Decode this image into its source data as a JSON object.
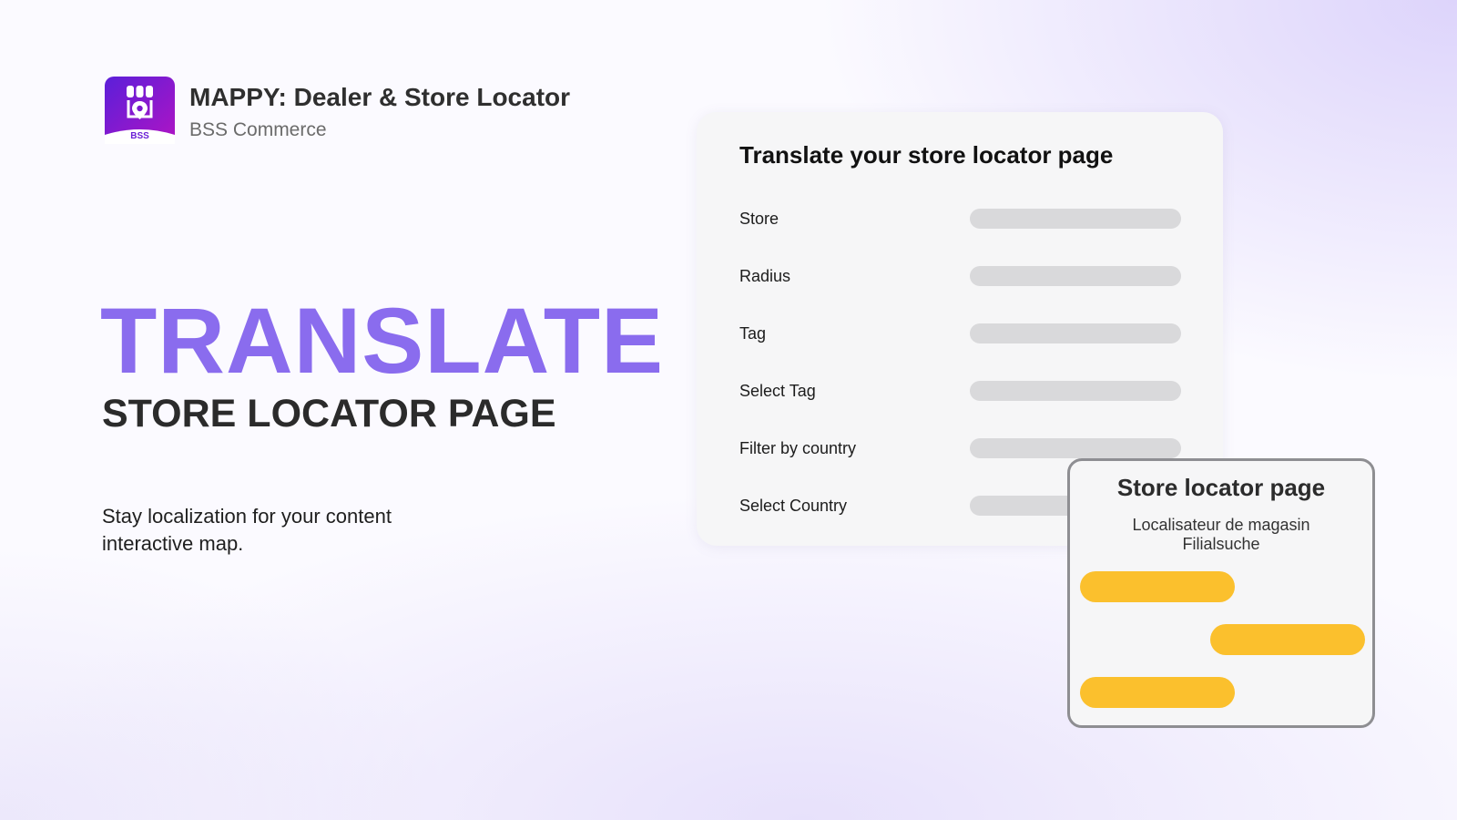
{
  "app": {
    "logo_text": "BSS",
    "title": "MAPPY: Dealer & Store Locator",
    "vendor": "BSS Commerce"
  },
  "hero": {
    "title": "TRANSLATE",
    "subtitle": "STORE LOCATOR PAGE",
    "description": "Stay localization for your content interactive map."
  },
  "translate_card": {
    "title": "Translate your store locator page",
    "fields": [
      {
        "label": "Store"
      },
      {
        "label": "Radius"
      },
      {
        "label": "Tag"
      },
      {
        "label": "Select Tag"
      },
      {
        "label": "Filter by country"
      },
      {
        "label": "Select Country"
      }
    ]
  },
  "locator_card": {
    "title": "Store locator page",
    "translations": [
      "Localisateur de magasin",
      "Filialsuche"
    ]
  },
  "colors": {
    "accent": "#8a6cee",
    "logo_gradient_start": "#6a1fd6",
    "logo_gradient_end": "#a312c9",
    "highlight": "#fbc02d",
    "placeholder_bar": "#d9d9db"
  }
}
